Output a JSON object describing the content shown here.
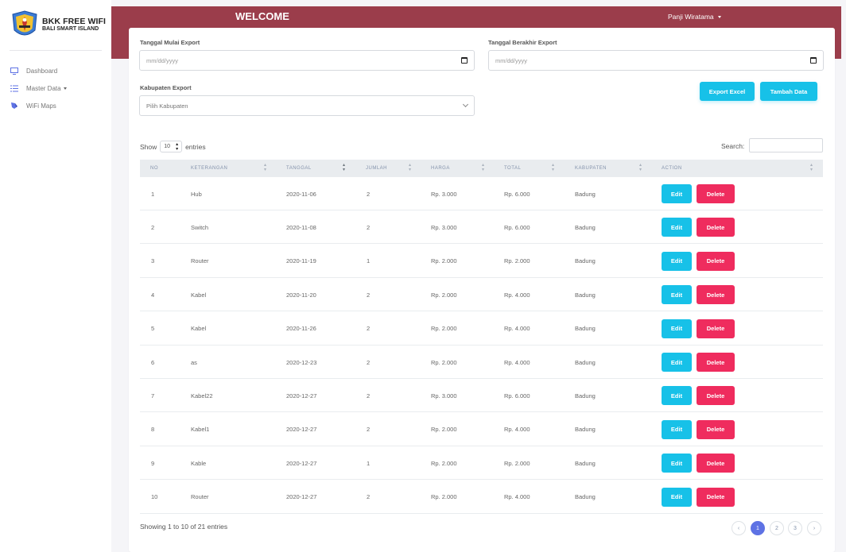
{
  "brand": {
    "line1": "BKK FREE WIFI",
    "line2": "BALI SMART ISLAND"
  },
  "sidebar": {
    "items": [
      {
        "label": "Dashboard",
        "icon": "monitor-icon"
      },
      {
        "label": "Master Data",
        "icon": "list-icon",
        "has_caret": true
      },
      {
        "label": "WiFi Maps",
        "icon": "map-icon"
      }
    ]
  },
  "header": {
    "title": "WELCOME",
    "user": "Panji Wiratama"
  },
  "filters": {
    "start_label": "Tanggal Mulai Export",
    "start_placeholder": "mm/dd/yyyy",
    "end_label": "Tanggal Berakhir Export",
    "end_placeholder": "mm/dd/yyyy",
    "kabupaten_label": "Kabupaten Export",
    "kabupaten_value": "Pilih Kabupaten"
  },
  "actions": {
    "export": "Export Excel",
    "add": "Tambah Data"
  },
  "table_controls": {
    "show": "Show",
    "length": "10",
    "entries": "entries",
    "search": "Search:"
  },
  "table": {
    "columns": [
      "NO",
      "KETERANGAN",
      "TANGGAL",
      "JUMLAH",
      "HARGA",
      "TOTAL",
      "KABUPATEN",
      "ACTION"
    ],
    "rows": [
      [
        "1",
        "Hub",
        "2020-11-06",
        "2",
        "Rp. 3.000",
        "Rp. 6.000",
        "Badung"
      ],
      [
        "2",
        "Switch",
        "2020-11-08",
        "2",
        "Rp. 3.000",
        "Rp. 6.000",
        "Badung"
      ],
      [
        "3",
        "Router",
        "2020-11-19",
        "1",
        "Rp. 2.000",
        "Rp. 2.000",
        "Badung"
      ],
      [
        "4",
        "Kabel",
        "2020-11-20",
        "2",
        "Rp. 2.000",
        "Rp. 4.000",
        "Badung"
      ],
      [
        "5",
        "Kabel",
        "2020-11-26",
        "2",
        "Rp. 2.000",
        "Rp. 4.000",
        "Badung"
      ],
      [
        "6",
        "as",
        "2020-12-23",
        "2",
        "Rp. 2.000",
        "Rp. 4.000",
        "Badung"
      ],
      [
        "7",
        "Kabel22",
        "2020-12-27",
        "2",
        "Rp. 3.000",
        "Rp. 6.000",
        "Badung"
      ],
      [
        "8",
        "Kabel1",
        "2020-12-27",
        "2",
        "Rp. 2.000",
        "Rp. 4.000",
        "Badung"
      ],
      [
        "9",
        "Kable",
        "2020-12-27",
        "1",
        "Rp. 2.000",
        "Rp. 2.000",
        "Badung"
      ],
      [
        "10",
        "Router",
        "2020-12-27",
        "2",
        "Rp. 2.000",
        "Rp. 4.000",
        "Badung"
      ]
    ],
    "edit_label": "Edit",
    "delete_label": "Delete"
  },
  "footer": {
    "info": "Showing 1 to 10 of 21 entries",
    "pages": [
      "‹",
      "1",
      "2",
      "3",
      "›"
    ],
    "active_page": "1"
  },
  "colors": {
    "header_band": "#9b3d4b",
    "accent_cyan": "#17c1e8",
    "danger": "#ef2c5e",
    "pager_active": "#5e72e4"
  }
}
